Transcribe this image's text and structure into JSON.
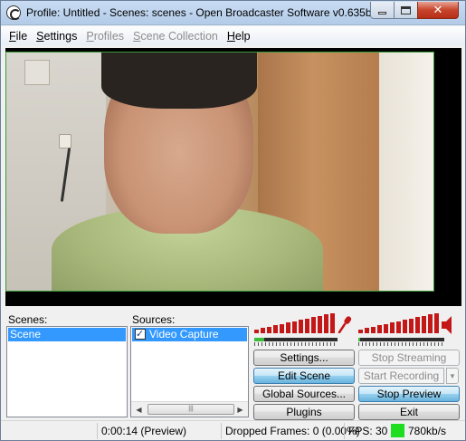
{
  "window": {
    "title": "Profile: Untitled - Scenes: scenes - Open Broadcaster Software v0.635b",
    "close_glyph": "✕"
  },
  "menu": [
    {
      "label": "File",
      "underline": "F",
      "rest": "ile",
      "enabled": true
    },
    {
      "label": "Settings",
      "underline": "S",
      "rest": "ettings",
      "enabled": true
    },
    {
      "label": "Profiles",
      "underline": "P",
      "rest": "rofiles",
      "enabled": false
    },
    {
      "label": "Scene Collection",
      "underline": "S",
      "rest": "cene Collection",
      "enabled": false
    },
    {
      "label": "Help",
      "underline": "H",
      "rest": "elp",
      "enabled": true
    }
  ],
  "scenes": {
    "label": "Scenes:",
    "items": [
      "Scene"
    ],
    "selected": "Scene"
  },
  "sources": {
    "label": "Sources:",
    "items": [
      {
        "name": "Video Capture Device",
        "checked": true
      }
    ],
    "scroll_left": "◀",
    "scroll_right": "▶",
    "scroll_grip": "|||"
  },
  "audio": {
    "mic_icon": "microphone-icon",
    "speaker_icon": "speaker-icon",
    "mic_level": 0.12,
    "desktop_level": 0.02,
    "mic_icon_glyph": "🎤"
  },
  "buttons": {
    "settings": "Settings...",
    "stop_streaming": "Stop Streaming",
    "edit_scene": "Edit Scene",
    "start_recording": "Start Recording",
    "recording_dropdown": "▼",
    "global_sources": "Global Sources...",
    "stop_preview": "Stop Preview",
    "plugins": "Plugins",
    "exit": "Exit"
  },
  "status": {
    "time": "0:00:14 (Preview)",
    "dropped_frames": "Dropped Frames: 0 (0.00%)",
    "fps": "FPS: 30",
    "bitrate": "780kb/s",
    "indicator_color": "#1fdd1f"
  }
}
